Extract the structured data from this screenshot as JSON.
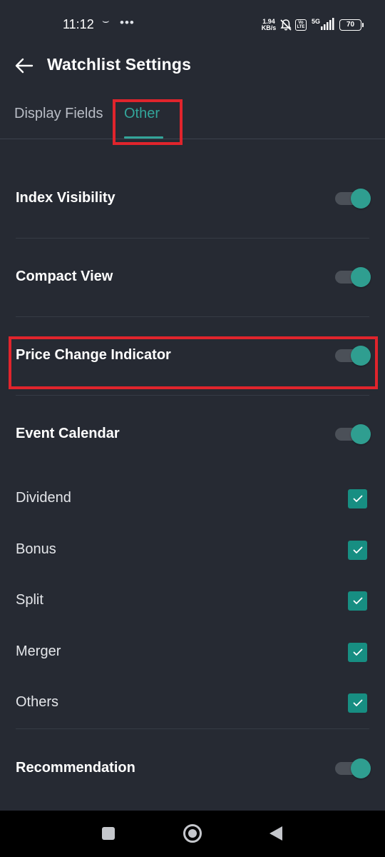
{
  "status_bar": {
    "time": "11:12",
    "speed_value": "1.94",
    "speed_unit": "KB/s",
    "network": "5G",
    "volte_top": "Vo",
    "volte_bottom": "LTE",
    "battery": "70"
  },
  "header": {
    "title": "Watchlist Settings"
  },
  "tabs": [
    {
      "label": "Display Fields",
      "active": false
    },
    {
      "label": "Other",
      "active": true
    }
  ],
  "settings": {
    "index_visibility": {
      "label": "Index Visibility",
      "enabled": true
    },
    "compact_view": {
      "label": "Compact View",
      "enabled": true
    },
    "price_change_indicator": {
      "label": "Price Change Indicator",
      "enabled": true
    },
    "event_calendar": {
      "label": "Event Calendar",
      "enabled": true,
      "options": [
        {
          "label": "Dividend",
          "checked": true
        },
        {
          "label": "Bonus",
          "checked": true
        },
        {
          "label": "Split",
          "checked": true
        },
        {
          "label": "Merger",
          "checked": true
        },
        {
          "label": "Others",
          "checked": true
        }
      ]
    },
    "recommendation": {
      "label": "Recommendation",
      "enabled": true
    }
  },
  "colors": {
    "background": "#262a33",
    "accent": "#33a59a",
    "checkbox": "#178e82",
    "highlight": "#e0242c"
  }
}
